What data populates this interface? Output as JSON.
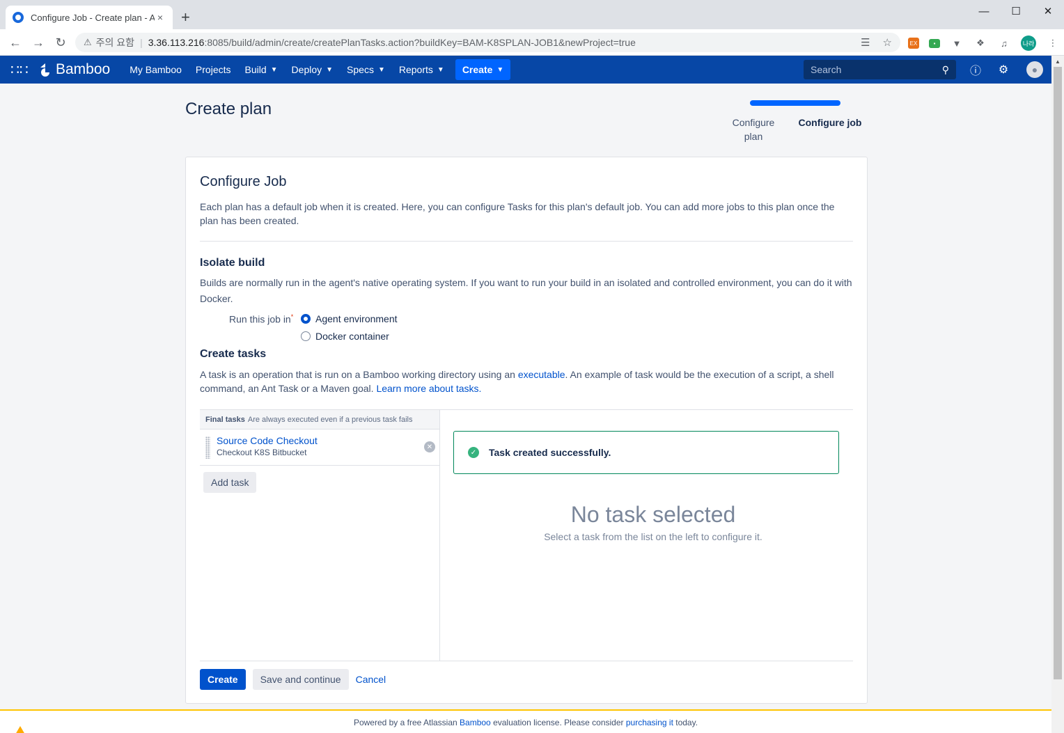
{
  "browser": {
    "tab_title": "Configure Job - Create plan - A",
    "tab_close": "×",
    "new_tab": "+",
    "security_label": "주의 요함",
    "url_host": "3.36.113.216",
    "url_path": ":8085/build/admin/create/createPlanTasks.action?buildKey=BAM-K8SPLAN-JOB1&newProject=true",
    "profile_initials": "나라"
  },
  "header": {
    "logo_text": "Bamboo",
    "nav": {
      "my_bamboo": "My Bamboo",
      "projects": "Projects",
      "build": "Build",
      "deploy": "Deploy",
      "specs": "Specs",
      "reports": "Reports"
    },
    "create_label": "Create",
    "search_placeholder": "Search"
  },
  "page": {
    "title": "Create plan",
    "progress": {
      "step1": "Configure plan",
      "step2": "Configure job",
      "current_step": 2
    }
  },
  "card": {
    "heading": "Configure Job",
    "description": "Each plan has a default job when it is created. Here, you can configure Tasks for this plan's default job. You can add more jobs to this plan once the plan has been created.",
    "isolate": {
      "heading": "Isolate build",
      "description": "Builds are normally run in the agent's native operating system. If you want to run your build in an isolated and controlled environment, you can do it with Docker.",
      "run_label": "Run this job in",
      "required_mark": "*",
      "option_agent": "Agent environment",
      "option_docker": "Docker container",
      "selected": "Agent environment"
    },
    "tasks": {
      "heading": "Create tasks",
      "desc_part1": "A task is an operation that is run on a Bamboo working directory using an ",
      "desc_link1": "executable",
      "desc_part2": ". An example of task would be the execution of a script, a shell command, an Ant Task or a Maven goal. ",
      "desc_link2": "Learn more about tasks.",
      "final_label": "Final tasks",
      "final_note": "Are always executed even if a previous task fails",
      "items": [
        {
          "name": "Source Code Checkout",
          "subtitle": "Checkout K8S Bitbucket"
        }
      ],
      "add_task": "Add task",
      "success_message": "Task created successfully.",
      "none_title": "No task selected",
      "none_sub": "Select a task from the list on the left to configure it."
    },
    "actions": {
      "create": "Create",
      "save_continue": "Save and continue",
      "cancel": "Cancel"
    }
  },
  "footer": {
    "part1": "Powered by a free Atlassian ",
    "link1": "Bamboo",
    "part2": " evaluation license. Please consider ",
    "link2": "purchasing it",
    "part3": " today."
  },
  "colors": {
    "header_bg": "#0747a6",
    "create_button": "#0065ff",
    "primary_button": "#0052cc",
    "success_border": "#00875a",
    "footer_warning": "#ffc400"
  }
}
